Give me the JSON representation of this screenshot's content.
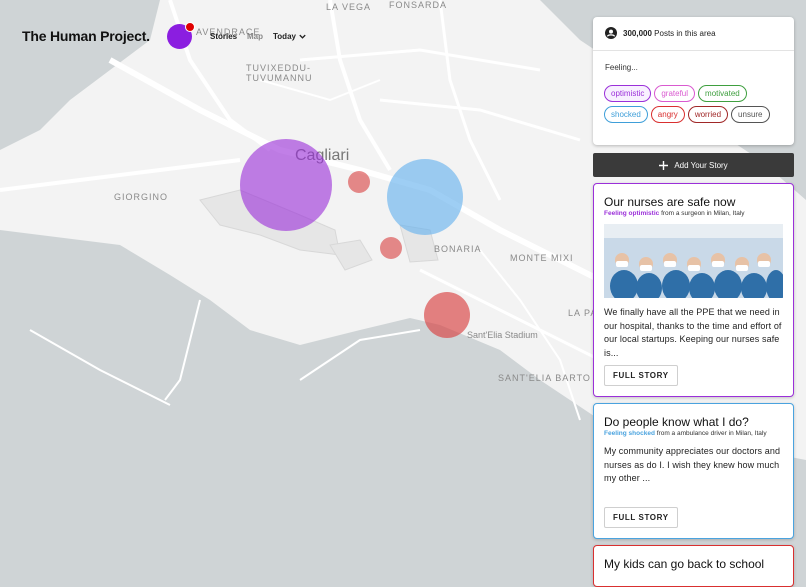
{
  "header": {
    "brand": "The Human Project.",
    "nav_stories": "Stories",
    "nav_map": "Map",
    "nav_today": "Today"
  },
  "map_labels": {
    "la_vega": "LA VEGA",
    "fonsarda": "FONSARDA",
    "avendrace": "AVENDRACE",
    "tuvixeddu_1": "TUVIXEDDU-",
    "tuvixeddu_2": "TUVUMANNU",
    "cagliari": "Cagliari",
    "giorgino": "GIORGINO",
    "bonaria": "BONARIA",
    "monte_mixi": "MONTE MIXI",
    "santelia_stadium": "Sant'Elia Stadium",
    "santelia_bartolo": "SANT'ELIA BARTO",
    "la_pa": "LA PA"
  },
  "filter": {
    "posts_count": "300,000",
    "posts_label": "Posts in this area",
    "feeling_label": "Feeling...",
    "chips": [
      {
        "label": "optimistic",
        "color": "#9b30d9",
        "fill": "#f8f0ff"
      },
      {
        "label": "grateful",
        "color": "#d95ad0",
        "fill": "#fff"
      },
      {
        "label": "motivated",
        "color": "#3f9f3f",
        "fill": "#fff"
      },
      {
        "label": "shocked",
        "color": "#3f9fd9",
        "fill": "#fff"
      },
      {
        "label": "angry",
        "color": "#d93030",
        "fill": "#fff"
      },
      {
        "label": "worried",
        "color": "#a02828",
        "fill": "#fff"
      },
      {
        "label": "unsure",
        "color": "#555555",
        "fill": "#fff"
      }
    ]
  },
  "add_story": {
    "label": "Add Your Story"
  },
  "stories": [
    {
      "title": "Our nurses are safe now",
      "feeling": "Feeling optimistic",
      "from": "from a surgeon in Milan, Italy",
      "body": "We finally have all the PPE that we need in our hospital, thanks to the time and effort of our local startups. Keeping our nurses safe is...",
      "button": "FULL STORY",
      "color": "#9b30d9"
    },
    {
      "title": "Do people know what I do?",
      "feeling": "Feeling shocked",
      "from": "from a ambulance driver in Milan, Italy",
      "body": "My community appreciates our doctors and nurses as do I. I wish they knew how much my other ...",
      "button": "FULL STORY",
      "color": "#4aa3df"
    },
    {
      "title": "My kids can go back to school",
      "color": "#d93030"
    }
  ],
  "colors": {
    "optimistic": "#9b30d9",
    "shocked": "#6ab4ee",
    "angry": "#d94040"
  }
}
